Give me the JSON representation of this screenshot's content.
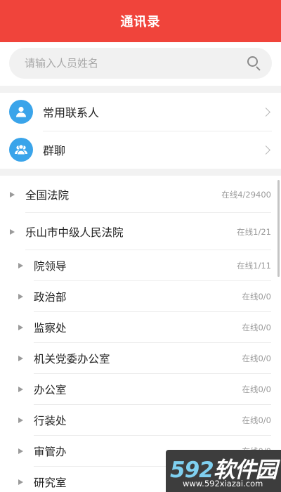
{
  "header": {
    "title": "通讯录"
  },
  "search": {
    "placeholder": "请输入人员姓名",
    "value": ""
  },
  "contacts": [
    {
      "label": "常用联系人",
      "icon": "person-icon"
    },
    {
      "label": "群聊",
      "icon": "group-icon"
    }
  ],
  "tree": {
    "orgs": [
      {
        "label": "全国法院",
        "status": "在线4/29400"
      },
      {
        "label": "乐山市中级人民法院",
        "status": "在线1/21"
      }
    ],
    "departments": [
      {
        "label": "院领导",
        "status": "在线1/11"
      },
      {
        "label": "政治部",
        "status": "在线0/0"
      },
      {
        "label": "监察处",
        "status": "在线0/0"
      },
      {
        "label": "机关党委办公室",
        "status": "在线0/0"
      },
      {
        "label": "办公室",
        "status": "在线0/0"
      },
      {
        "label": "行装处",
        "status": "在线0/0"
      },
      {
        "label": "审管办",
        "status": "在线0/0"
      },
      {
        "label": "研究室",
        "status": ""
      }
    ]
  },
  "watermark": {
    "num": "592",
    "text": "软件园",
    "url": "www.592xiazai.com"
  },
  "colors": {
    "header": "#f0443b",
    "avatar": "#3aa4ea"
  }
}
